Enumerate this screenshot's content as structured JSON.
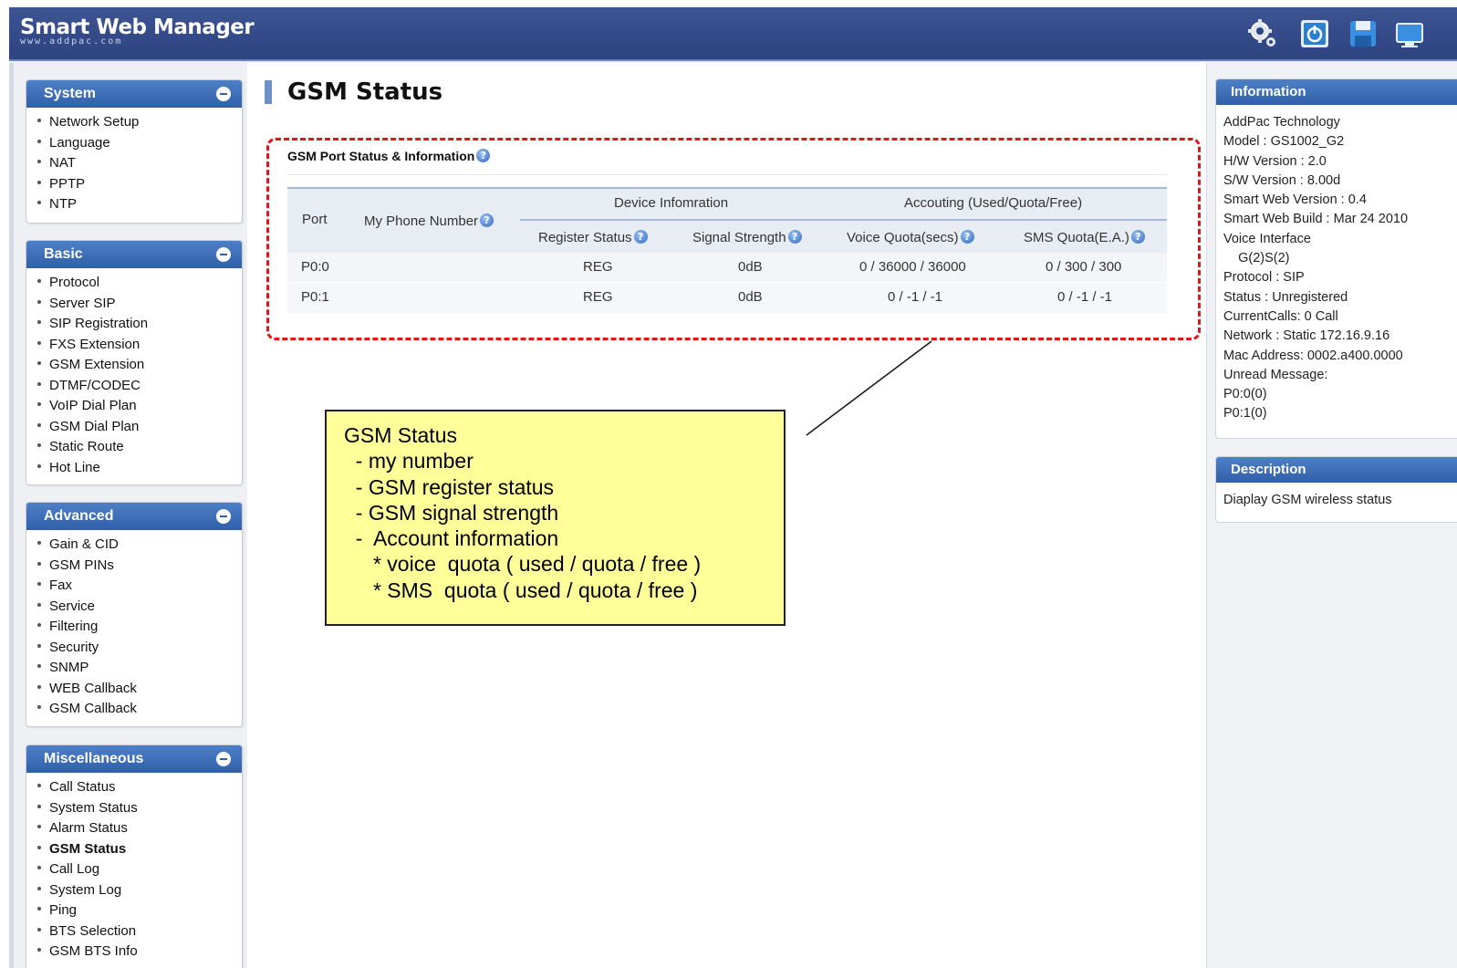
{
  "header": {
    "brand_title": "Smart Web Manager",
    "brand_sub": "www.addpac.com",
    "icons": [
      "settings-gears-icon",
      "power-icon",
      "save-disk-icon",
      "monitor-icon"
    ]
  },
  "sidebar": {
    "panels": [
      {
        "title": "System",
        "items": [
          "Network Setup",
          "Language",
          "NAT",
          "PPTP",
          "NTP"
        ]
      },
      {
        "title": "Basic",
        "items": [
          "Protocol",
          "Server SIP",
          "SIP Registration",
          "FXS Extension",
          "GSM Extension",
          "DTMF/CODEC",
          "VoIP Dial Plan",
          "GSM Dial Plan",
          "Static Route",
          "Hot Line"
        ]
      },
      {
        "title": "Advanced",
        "items": [
          "Gain & CID",
          "GSM PINs",
          "Fax",
          "Service",
          "Filtering",
          "Security",
          "SNMP",
          "WEB Callback",
          "GSM Callback"
        ]
      },
      {
        "title": "Miscellaneous",
        "items": [
          "Call Status",
          "System Status",
          "Alarm Status",
          "GSM Status",
          "Call Log",
          "System Log",
          "Ping",
          "BTS Selection",
          "GSM BTS Info"
        ]
      }
    ],
    "active_item": "GSM Status"
  },
  "main": {
    "page_title": "GSM Status",
    "section_title": "GSM Port Status & Information",
    "table": {
      "header_port": "Port",
      "header_phone": "My Phone Number",
      "group_device": "Device Infomration",
      "group_accounting": "Accouting (Used/Quota/Free)",
      "header_register": "Register Status",
      "header_signal": "Signal Strength",
      "header_voice": "Voice Quota(secs)",
      "header_sms": "SMS Quota(E.A.)",
      "rows": [
        {
          "port": "P0:0",
          "phone": "",
          "register": "REG",
          "signal": "0dB",
          "voice": "0 / 36000 / 36000",
          "sms": "0 / 300 / 300"
        },
        {
          "port": "P0:1",
          "phone": "",
          "register": "REG",
          "signal": "0dB",
          "voice": "0 / -1 / -1",
          "sms": "0 / -1 / -1"
        }
      ]
    }
  },
  "callout": {
    "lines": [
      "GSM Status",
      "  - my number",
      "  - GSM register status",
      "  - GSM signal strength",
      "  -  Account information",
      "     * voice  quota ( used / quota / free )",
      "     * SMS  quota ( used / quota / free )"
    ]
  },
  "information": {
    "title": "Information",
    "lines": [
      "AddPac Technology",
      "Model : GS1002_G2",
      "H/W Version : 2.0",
      "S/W Version : 8.00d",
      "Smart Web Version : 0.4",
      "Smart Web Build : Mar 24 2010",
      "Voice Interface",
      "    G(2)S(2)",
      "Protocol : SIP",
      "Status : Unregistered",
      "CurrentCalls: 0 Call",
      "Network : Static 172.16.9.16",
      "Mac Address: 0002.a400.0000",
      "Unread Message:",
      "P0:0(0)",
      "P0:1(0)"
    ]
  },
  "description": {
    "title": "Description",
    "text": "Diaplay GSM wireless status"
  }
}
